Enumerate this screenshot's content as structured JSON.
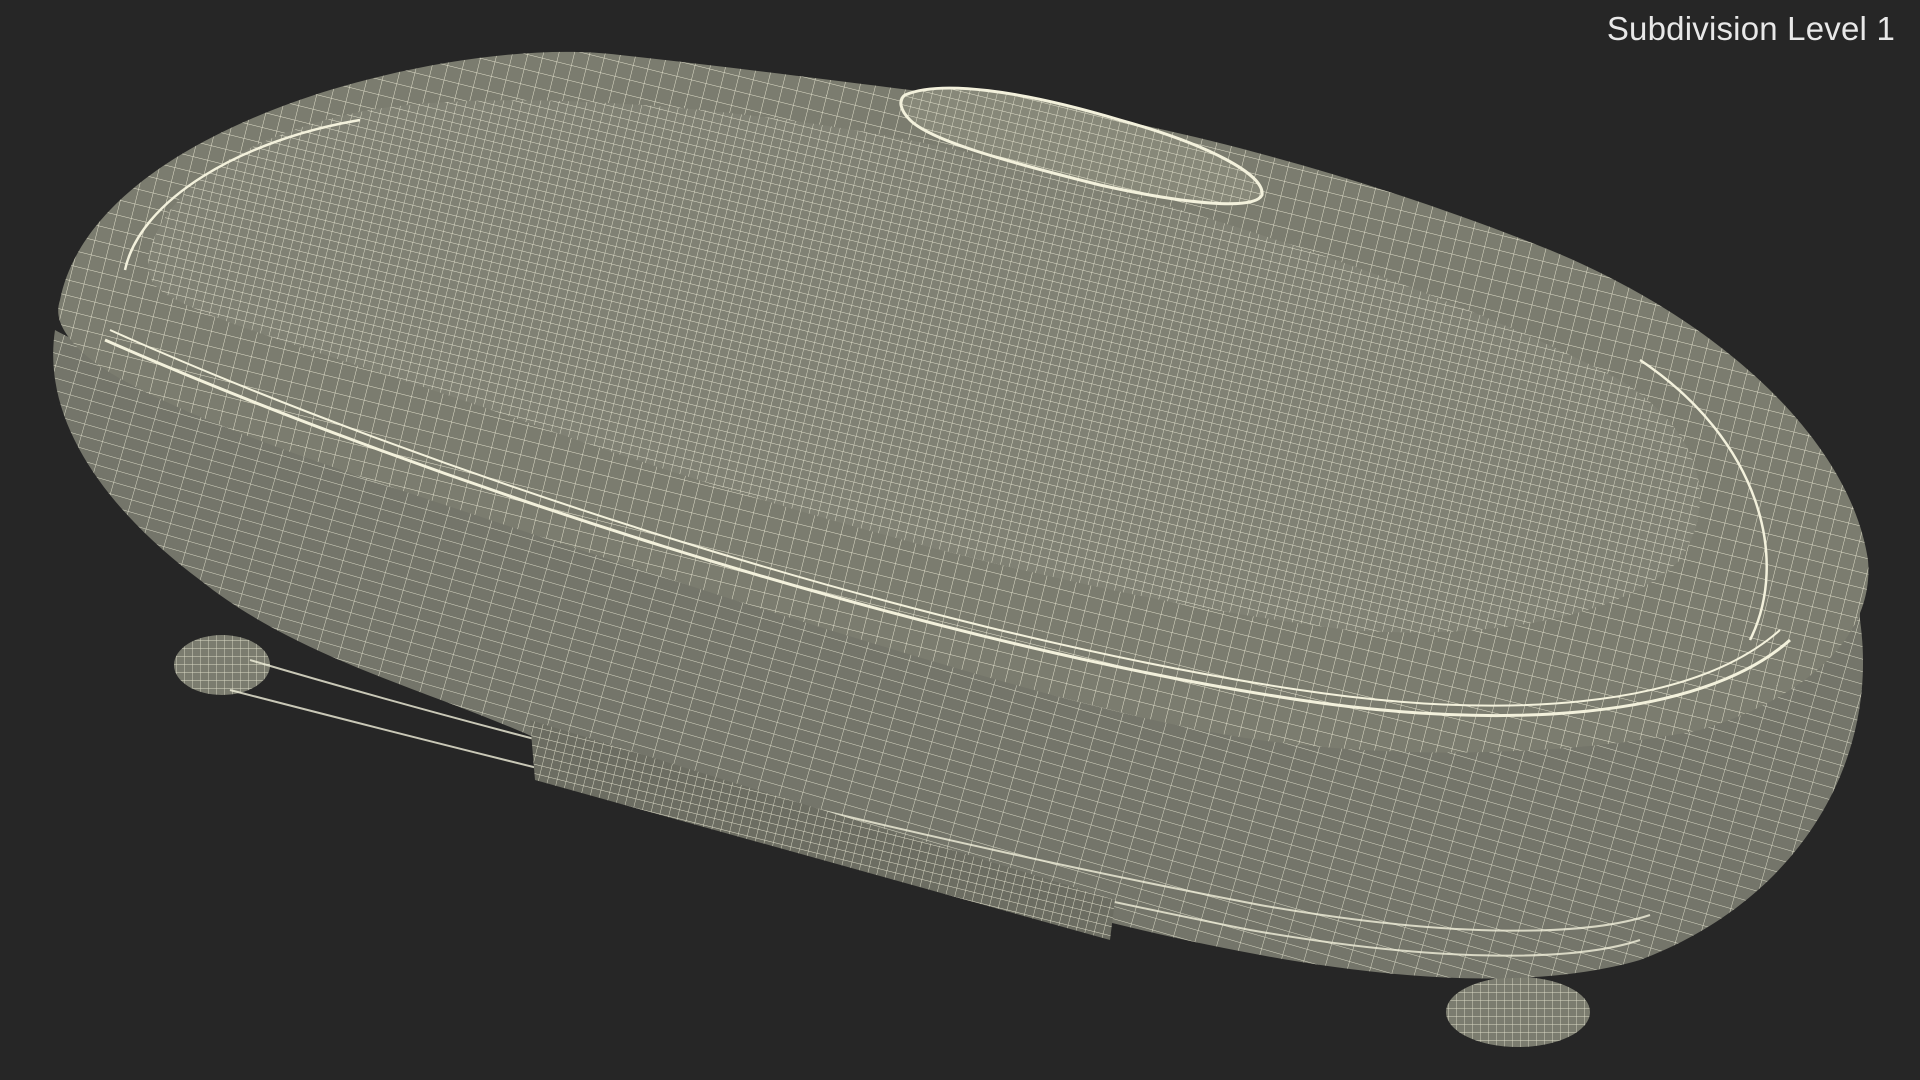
{
  "overlay": {
    "subdivision_label": "Subdivision Level 1"
  },
  "scene": {
    "subject": "vibration-plate-wireframe",
    "background_color": "#262626",
    "mesh_fill_color": "#7b7c6f",
    "mesh_shadow_color": "#5f6055",
    "wire_color": "#f3f1dc"
  }
}
